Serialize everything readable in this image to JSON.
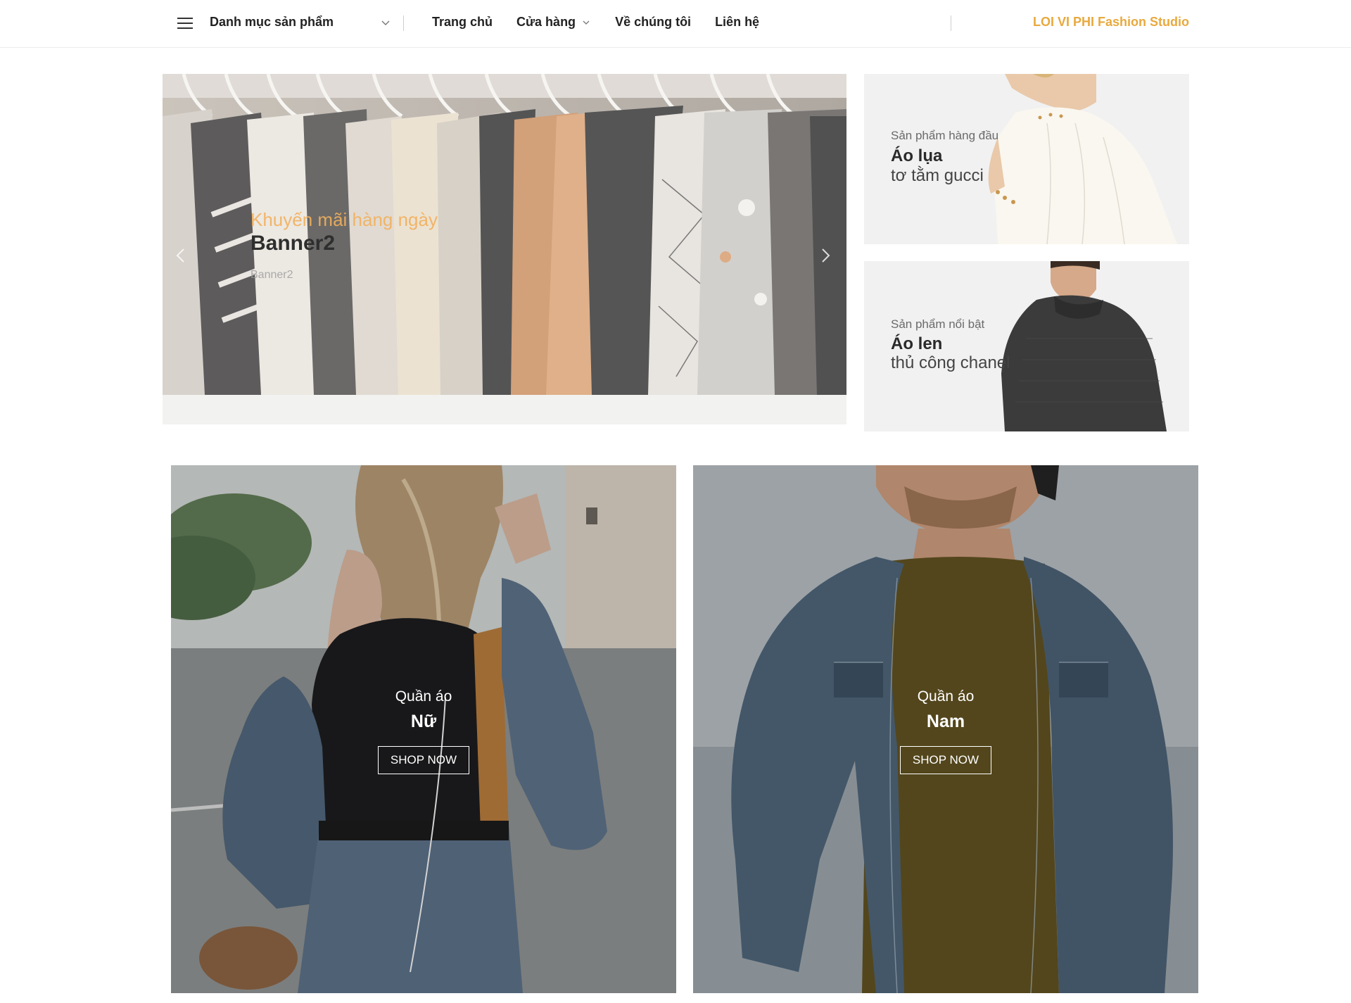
{
  "header": {
    "category_menu_label": "Danh mục sản phẩm",
    "nav": [
      {
        "label": "Trang chủ",
        "has_dropdown": false
      },
      {
        "label": "Cửa hàng",
        "has_dropdown": true
      },
      {
        "label": "Về chúng tôi",
        "has_dropdown": false
      },
      {
        "label": "Liên hệ",
        "has_dropdown": false
      }
    ],
    "brand": "LOI VI PHI Fashion Studio",
    "icons": [
      "menu-icon",
      "chevron-down-icon"
    ]
  },
  "hero": {
    "subtitle": "Khuyến mãi hàng ngày",
    "title": "Banner2",
    "caption": "Banner2",
    "icons": [
      "chevron-left-icon",
      "chevron-right-icon"
    ]
  },
  "promos": [
    {
      "subtitle": "Sản phẩm hàng đầu",
      "title": "Áo lụa",
      "desc": "tơ tằm gucci"
    },
    {
      "subtitle": "Sản phẩm nổi bật",
      "title": "Áo len",
      "desc": "thủ công chanel"
    }
  ],
  "categories": [
    {
      "subtitle": "Quần áo",
      "title": "Nữ",
      "button": "SHOP NOW"
    },
    {
      "subtitle": "Quần áo",
      "title": "Nam",
      "button": "SHOP NOW"
    }
  ],
  "colors": {
    "accent": "#e8a93e",
    "text": "#222222",
    "header_border": "#ececec"
  }
}
